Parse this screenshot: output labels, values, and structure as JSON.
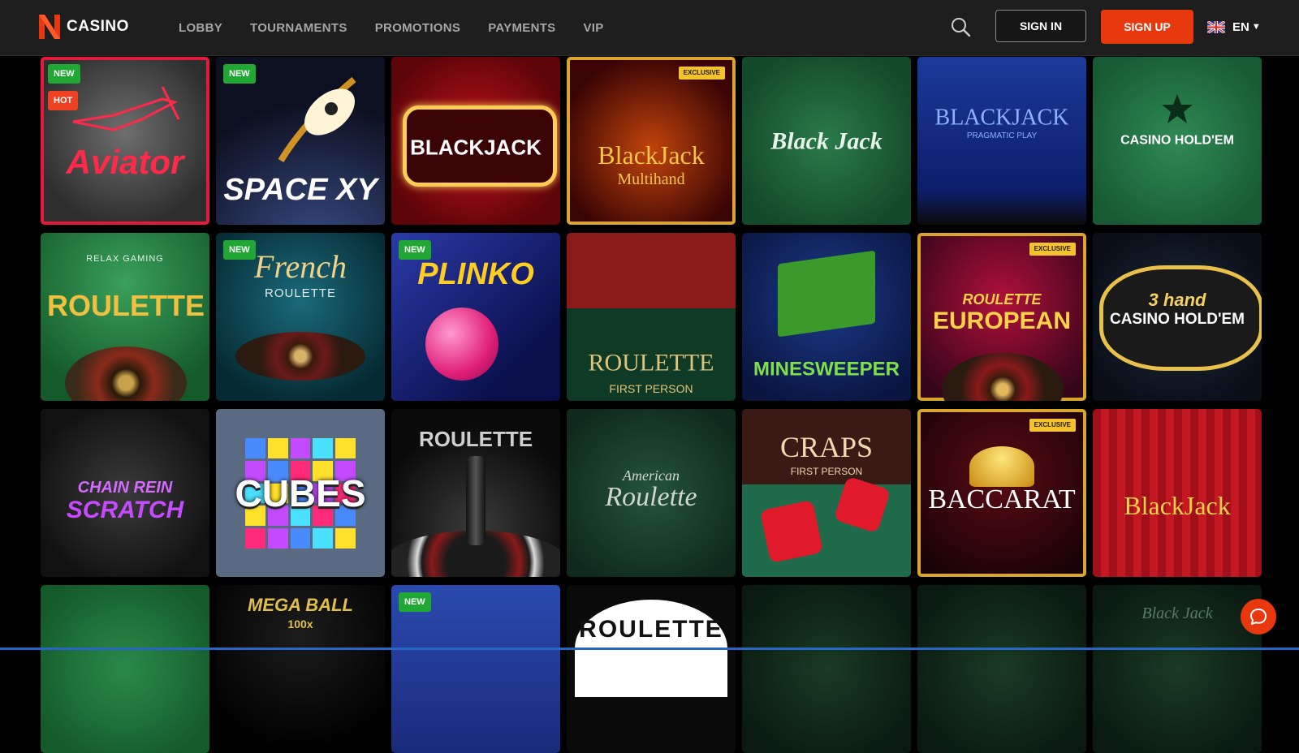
{
  "brand": {
    "name": "CASINO",
    "accent": "#e8380d"
  },
  "nav": [
    {
      "label": "LOBBY"
    },
    {
      "label": "TOURNAMENTS"
    },
    {
      "label": "PROMOTIONS"
    },
    {
      "label": "PAYMENTS"
    },
    {
      "label": "VIP"
    }
  ],
  "header": {
    "search_icon": "search-icon",
    "sign_in": "SIGN IN",
    "sign_up": "SIGN UP",
    "language": "EN",
    "flag": "uk-flag-icon"
  },
  "badges": {
    "new": "NEW",
    "hot": "HOT",
    "exclusive": "EXCLUSIVE"
  },
  "games": [
    {
      "title": "Aviator",
      "badges": [
        "NEW",
        "HOT"
      ]
    },
    {
      "title": "SPACE XY",
      "badges": [
        "NEW"
      ]
    },
    {
      "title": "BLACKJACK",
      "badges": []
    },
    {
      "title": "BlackJack",
      "subtitle": "Multihand",
      "badges": [
        "EXCLUSIVE"
      ]
    },
    {
      "title": "Black Jack",
      "badges": []
    },
    {
      "title": "BLACKJACK",
      "subtitle": "PRAGMATIC PLAY",
      "badges": []
    },
    {
      "title": "CASINO HOLD'EM",
      "badges": []
    },
    {
      "title": "ROULETTE",
      "subtitle": "RELAX GAMING",
      "badges": []
    },
    {
      "title": "French",
      "subtitle": "ROULETTE",
      "badges": [
        "NEW"
      ]
    },
    {
      "title": "PLINKO",
      "badges": [
        "NEW"
      ]
    },
    {
      "title": "ROULETTE",
      "subtitle": "FIRST PERSON",
      "badges": []
    },
    {
      "title": "MINESWEEPER",
      "badges": []
    },
    {
      "title": "ROULETTE",
      "subtitle": "EUROPEAN",
      "badges": [
        "EXCLUSIVE"
      ]
    },
    {
      "title": "3 hand",
      "subtitle": "CASINO HOLD'EM",
      "badges": []
    },
    {
      "title": "CHAIN REIN",
      "subtitle": "SCRATCH",
      "badges": []
    },
    {
      "title": "CUBES",
      "badges": []
    },
    {
      "title": "ROULETTE",
      "badges": []
    },
    {
      "title": "American",
      "subtitle": "Roulette",
      "badges": []
    },
    {
      "title": "CRAPS",
      "subtitle": "FIRST PERSON",
      "badges": []
    },
    {
      "title": "BACCARAT",
      "badges": [
        "EXCLUSIVE"
      ]
    },
    {
      "title": "BlackJack",
      "badges": []
    },
    {
      "title": "",
      "badges": []
    },
    {
      "title": "MEGA BALL",
      "subtitle": "100x",
      "badges": []
    },
    {
      "title": "",
      "badges": [
        "NEW"
      ]
    },
    {
      "title": "ROULETTE",
      "badges": []
    },
    {
      "title": "",
      "badges": []
    },
    {
      "title": "",
      "badges": []
    },
    {
      "title": "Black Jack",
      "badges": []
    }
  ],
  "chat_icon": "chat-bubble-icon"
}
